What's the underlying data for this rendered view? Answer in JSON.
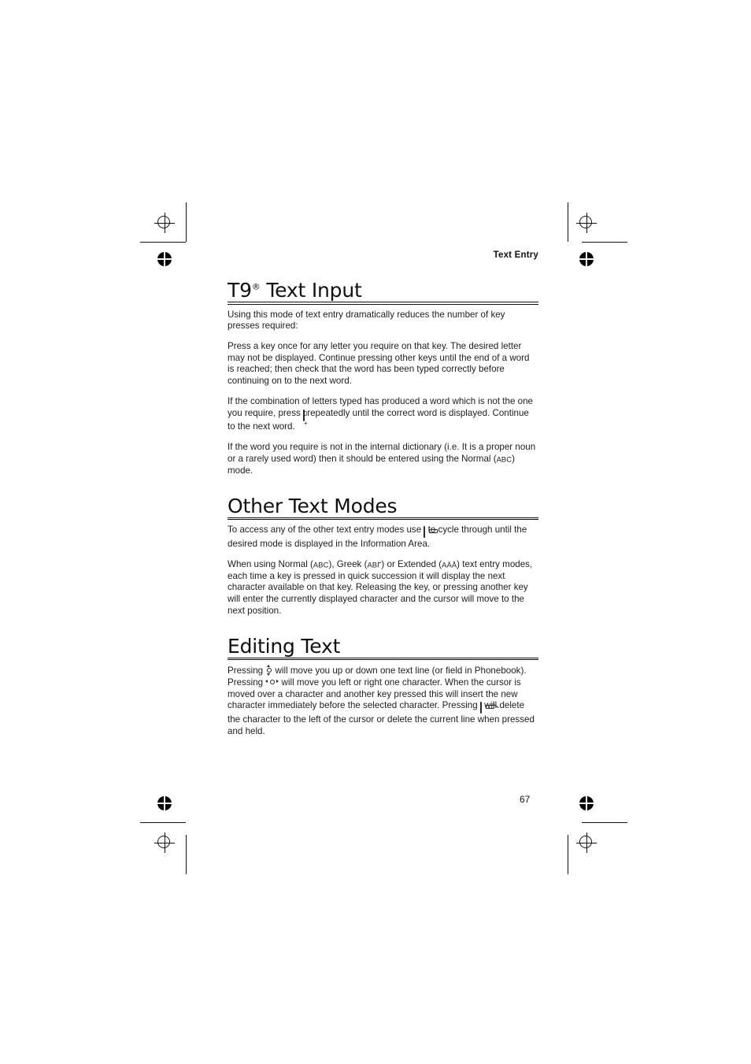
{
  "page": {
    "running_head": "Text Entry",
    "page_number": "67"
  },
  "sections": [
    {
      "id": "t9-text-input",
      "heading": "T9",
      "heading_superscript": "®",
      "heading_rest": " Text Input",
      "paragraphs": [
        "Using this mode of text entry dramatically reduces the number of key presses required:",
        "Press a key once for any letter you require on that key. The desired letter may not be displayed. Continue pressing other keys until the end of a word is reached; then check that the word has been typed correctly before continuing on to the next word.",
        "If the combination of letters typed has produced a word which is not the one you require, press ",
        " repeatedly until the correct word is displayed. Continue to the next word.",
        "If the word you require is not in the internal dictionary (i.e. It is a proper noun or a rarely used word) then it should be entered using the Normal (",
        "ABC",
        ") mode."
      ]
    },
    {
      "id": "other-text-modes",
      "heading": "Other Text Modes",
      "paragraphs": [
        "To access any of the other text entry modes use ",
        " to cycle through until the desired mode is displayed in the Information Area.",
        "When using Normal (",
        "ABC",
        "), Greek (",
        "ABΓ",
        ") or Extended (",
        "AÄÅ",
        ") text entry modes, each time a key is pressed in quick succession it will display the next character available on that key. Releasing the key, or pressing another key will enter the currently displayed character and the cursor will move to the next position."
      ]
    },
    {
      "id": "editing-text",
      "heading": "Editing Text",
      "paragraphs": [
        "Pressing ",
        " will move you up or down one text line (or field in Phonebook). Pressing ",
        " will move you left or right one character. When the cursor is moved over a character and another key pressed this will insert the new character immediately before the selected character. Pressing ",
        " will delete the character to the left of the cursor or delete the current line when pressed and held."
      ]
    }
  ],
  "icons": {
    "zero_key_label": "0 +",
    "mode_cycle_key": "mode-cycle-key-icon",
    "delete_key": "delete-key-icon",
    "nav_up_down": "nav-up-down-icon",
    "nav_left_right": "nav-left-right-icon"
  },
  "colors": {
    "text": "#1d1d1d",
    "rule": "#111111",
    "background": "#ffffff"
  }
}
